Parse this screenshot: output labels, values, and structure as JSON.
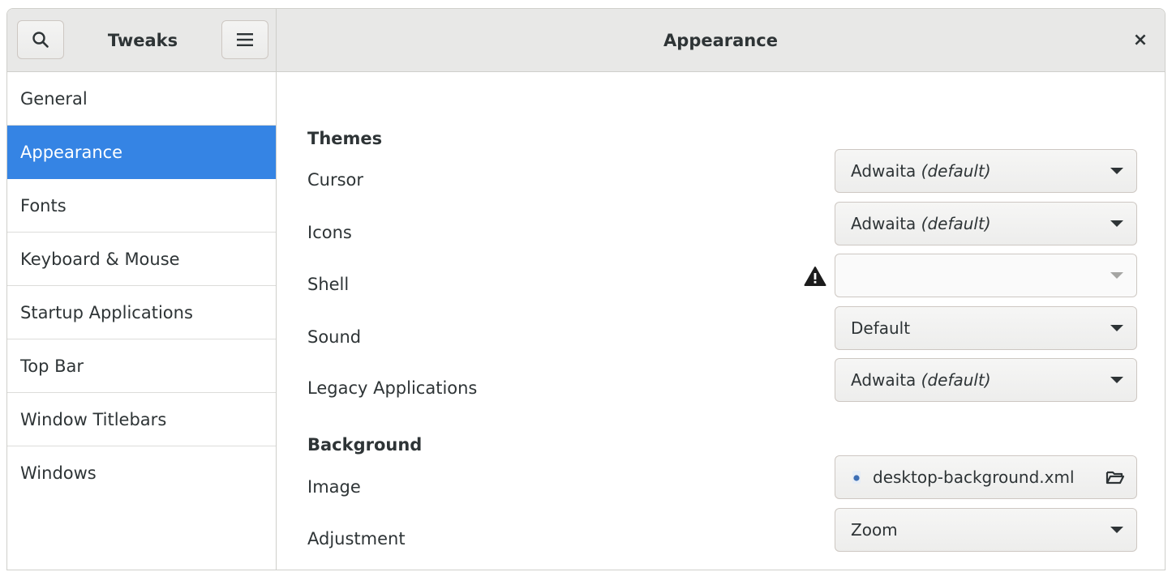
{
  "header": {
    "app_title": "Tweaks",
    "page_title": "Appearance",
    "close_label": "×"
  },
  "sidebar": {
    "items": [
      {
        "label": "General"
      },
      {
        "label": "Appearance",
        "active": true
      },
      {
        "label": "Fonts"
      },
      {
        "label": "Keyboard & Mouse"
      },
      {
        "label": "Startup Applications"
      },
      {
        "label": "Top Bar"
      },
      {
        "label": "Window Titlebars"
      },
      {
        "label": "Windows"
      }
    ]
  },
  "themes": {
    "heading": "Themes",
    "cursor": {
      "label": "Cursor",
      "value": "Adwaita",
      "suffix": "(default)"
    },
    "icons": {
      "label": "Icons",
      "value": "Adwaita",
      "suffix": "(default)"
    },
    "shell": {
      "label": "Shell",
      "value": "",
      "warning": true
    },
    "sound": {
      "label": "Sound",
      "value": "Default"
    },
    "legacy": {
      "label": "Legacy Applications",
      "value": "Adwaita",
      "suffix": "(default)"
    }
  },
  "background": {
    "heading": "Background",
    "image": {
      "label": "Image",
      "value": "desktop-background.xml"
    },
    "adjustment": {
      "label": "Adjustment",
      "value": "Zoom"
    }
  },
  "colors": {
    "accent": "#3584e4",
    "headerbar": "#e8e8e7",
    "text": "#2e3436"
  },
  "icons": [
    "search-icon",
    "hamburger-menu-icon",
    "close-icon",
    "warning-icon",
    "file-icon",
    "folder-open-icon",
    "chevron-down-icon"
  ]
}
